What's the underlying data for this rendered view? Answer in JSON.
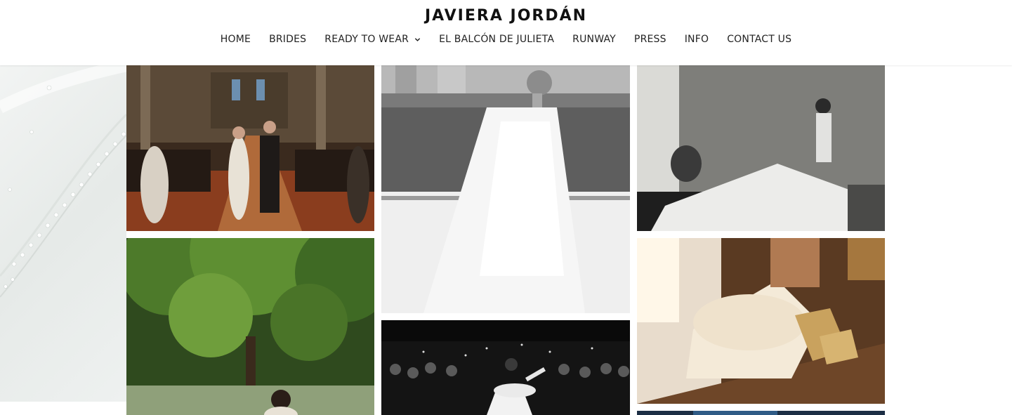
{
  "header": {
    "logo": "JAVIERA JORDÁN",
    "nav": [
      {
        "label": "HOME"
      },
      {
        "label": "BRIDES"
      },
      {
        "label": "READY TO WEAR",
        "has_dropdown": true
      },
      {
        "label": "EL BALCÓN DE JULIETA"
      },
      {
        "label": "RUNWAY"
      },
      {
        "label": "PRESS"
      },
      {
        "label": "INFO"
      },
      {
        "label": "CONTACT US"
      }
    ]
  },
  "gallery": {
    "tiles": [
      {
        "subject": "church-aisle-wedding-photo"
      },
      {
        "subject": "garden-trees-bride-photo"
      },
      {
        "subject": "bride-seated-window-photo"
      },
      {
        "subject": "bride-dancing-party-photo"
      },
      {
        "subject": "bride-dress-train-photo"
      },
      {
        "subject": "bride-gold-shoes-photo"
      },
      {
        "subject": "partial-blue-photo"
      }
    ]
  },
  "colors": {
    "text": "#222222",
    "background": "#ffffff",
    "left_panel": "#eef1f0"
  }
}
